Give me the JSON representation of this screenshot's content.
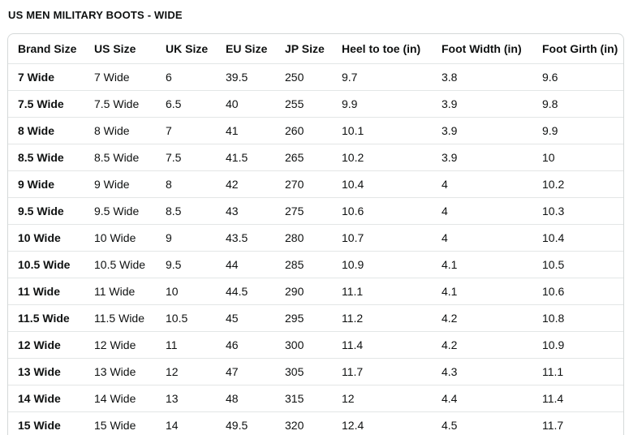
{
  "title": "US MEN MILITARY BOOTS - WIDE",
  "table": {
    "headers": [
      "Brand Size",
      "US Size",
      "UK Size",
      "EU Size",
      "JP Size",
      "Heel to toe (in)",
      "Foot Width (in)",
      "Foot Girth (in)"
    ],
    "rows": [
      [
        "7 Wide",
        "7 Wide",
        "6",
        "39.5",
        "250",
        "9.7",
        "3.8",
        "9.6"
      ],
      [
        "7.5 Wide",
        "7.5 Wide",
        "6.5",
        "40",
        "255",
        "9.9",
        "3.9",
        "9.8"
      ],
      [
        "8 Wide",
        "8 Wide",
        "7",
        "41",
        "260",
        "10.1",
        "3.9",
        "9.9"
      ],
      [
        "8.5 Wide",
        "8.5 Wide",
        "7.5",
        "41.5",
        "265",
        "10.2",
        "3.9",
        "10"
      ],
      [
        "9 Wide",
        "9 Wide",
        "8",
        "42",
        "270",
        "10.4",
        "4",
        "10.2"
      ],
      [
        "9.5 Wide",
        "9.5 Wide",
        "8.5",
        "43",
        "275",
        "10.6",
        "4",
        "10.3"
      ],
      [
        "10 Wide",
        "10 Wide",
        "9",
        "43.5",
        "280",
        "10.7",
        "4",
        "10.4"
      ],
      [
        "10.5 Wide",
        "10.5 Wide",
        "9.5",
        "44",
        "285",
        "10.9",
        "4.1",
        "10.5"
      ],
      [
        "11 Wide",
        "11 Wide",
        "10",
        "44.5",
        "290",
        "11.1",
        "4.1",
        "10.6"
      ],
      [
        "11.5 Wide",
        "11.5 Wide",
        "10.5",
        "45",
        "295",
        "11.2",
        "4.2",
        "10.8"
      ],
      [
        "12 Wide",
        "12 Wide",
        "11",
        "46",
        "300",
        "11.4",
        "4.2",
        "10.9"
      ],
      [
        "13 Wide",
        "13 Wide",
        "12",
        "47",
        "305",
        "11.7",
        "4.3",
        "11.1"
      ],
      [
        "14 Wide",
        "14 Wide",
        "13",
        "48",
        "315",
        "12",
        "4.4",
        "11.4"
      ],
      [
        "15 Wide",
        "15 Wide",
        "14",
        "49.5",
        "320",
        "12.4",
        "4.5",
        "11.7"
      ]
    ]
  },
  "colors": {
    "text": "#0f1111",
    "border": "#d5d9d9",
    "row_divider": "#e3e6e6"
  }
}
